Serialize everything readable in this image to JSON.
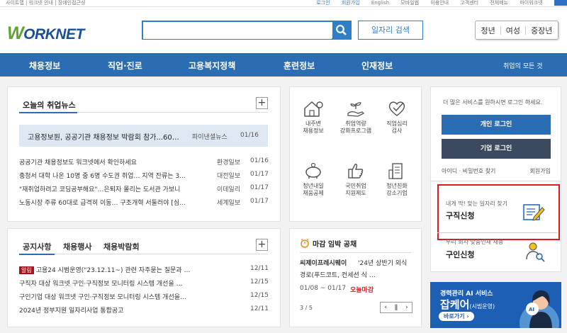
{
  "topbar": {
    "left": "사이트맵 | 워크넷 안내 | 장애인접근성",
    "right": [
      "로그인",
      "회원가입",
      "English",
      "모바일웹",
      "이용안내",
      "고객센터",
      "전체메뉴",
      "마이워크넷"
    ]
  },
  "header": {
    "logo_w": "W",
    "logo_rest": "ORKNET",
    "search_placeholder": "",
    "job_search_label": "일자리 검색",
    "age_tabs": [
      "청년",
      "여성",
      "중장년"
    ]
  },
  "nav": {
    "items": [
      "채용정보",
      "직업·진로",
      "고용복지정책",
      "훈련정보",
      "인재정보"
    ],
    "all_menu": "취업의 모든 것"
  },
  "news": {
    "title": "오늘의 취업뉴스",
    "highlight": {
      "title": "고용정보원, 공공기관 채용정보 박람회 참가...60…",
      "source": "파이낸셜뉴스",
      "date": "01/16"
    },
    "items": [
      {
        "title": "공공기관 채용정보도 워크넷에서 확인하세요",
        "source": "환경일보",
        "date": "01/16"
      },
      {
        "title": "충청서 대학 나온 10명 중 6명 수도권 취업… 지역 잔류는 3…",
        "source": "대전일보",
        "date": "01/17"
      },
      {
        "title": "\"재취업하려고 코딩공부해요\"…은퇴자 몰리는 도서관 가보니",
        "source": "이데일리",
        "date": "01/17"
      },
      {
        "title": "노동시장 주류 60대로 급격히 이동… 구조개혁 서둘러야 [심…",
        "source": "세계일보",
        "date": "01/17"
      }
    ]
  },
  "notice": {
    "tabs": [
      "공지사항",
      "채용행사",
      "채용박람회"
    ],
    "badge": "알림",
    "items": [
      {
        "title": "고용24 시범운영(\"23.12.11~) 관련 자주묻는 질문과 …",
        "date": "12/11"
      },
      {
        "title": "구직자 대상 워크넷 구인·구직정보 모니터링 시스템 개선을 …",
        "date": "12/15"
      },
      {
        "title": "구인기업 대상 워크넷 구인·구직정보 모니터링 시스템 개선을…",
        "date": "12/15"
      },
      {
        "title": "2024년 정부지원 일자리사업 통합공고",
        "date": "12/11"
      }
    ]
  },
  "services": [
    {
      "l1": "내주변",
      "l2": "채용정보",
      "icon": "house-pin-icon"
    },
    {
      "l1": "취업역량",
      "l2": "강화프로그램",
      "icon": "hand-sprout-icon"
    },
    {
      "l1": "직업심리",
      "l2": "검사",
      "icon": "heart-check-icon"
    },
    {
      "l1": "청년내일",
      "l2": "채움공제",
      "icon": "piggy-bank-icon"
    },
    {
      "l1": "국민취업",
      "l2": "지원제도",
      "icon": "thumbs-up-icon"
    },
    {
      "l1": "청년친화",
      "l2": "강소기업",
      "icon": "building-icon"
    }
  ],
  "deadline": {
    "title": "마감 임박 공채",
    "company": "씨제이프레시웨이",
    "desc1": "'24년 상반기 외식",
    "desc2": "경로(푸드코트, 컨세션 식 …",
    "period": "01/08 ~ 01/17",
    "tag": "오늘마감",
    "page": "3 / 5",
    "pager_glyphs": [
      "‹",
      "ǁ",
      "›"
    ]
  },
  "login": {
    "msg": "더 많은 서비스를 원하시면 로그인 하세요.",
    "personal": "개인 로그인",
    "company": "기업 로그인",
    "find": "아이디 · 비밀번호 찾기",
    "join": "회원가입"
  },
  "jobseek": {
    "sub": "내게 딱! 맞는 일자리 찾기",
    "title": "구직신청"
  },
  "recruit": {
    "sub": "우리 회사 맞춤인재 채용",
    "title": "구인신청"
  },
  "banner": {
    "line1": "경력관리 AI 서비스",
    "line2": "잡케어",
    "line2_sub": "(시범운영)",
    "go": "바로가기 ›"
  },
  "colors": {
    "brand": "#2b6db3",
    "green": "#5aa52c",
    "red": "#e3171f",
    "dark_btn": "#3b4a5e",
    "orange": "#f08a1d"
  }
}
